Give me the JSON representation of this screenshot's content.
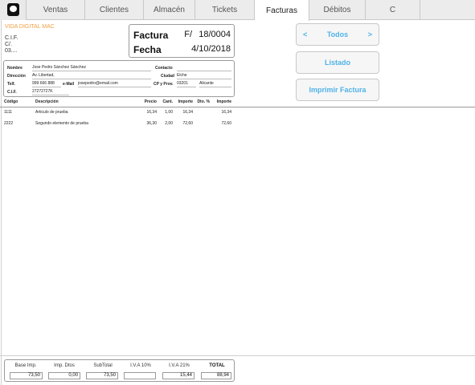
{
  "tabs": [
    "Ventas",
    "Clientes",
    "Almacén",
    "Tickets",
    "Facturas",
    "Débitos",
    "C"
  ],
  "active_tab": "Facturas",
  "company": {
    "name": "VIDA DIGITAL MAC",
    "cif": "C.I.F.",
    "line2": "C/.",
    "line3": "03...."
  },
  "invoice": {
    "factura_label": "Factura",
    "factura_prefix": "F/",
    "factura_number": "18/0004",
    "fecha_label": "Fecha",
    "fecha_value": "4/10/2018"
  },
  "customer": {
    "nombre_label": "Nombre",
    "nombre": "Jose Pedro Sánchez Sánchez",
    "contacto_label": "Contacto",
    "contacto": "",
    "direccion_label": "Dirección",
    "direccion": "Av. Libertad,",
    "ciudad_label": "Ciudad",
    "ciudad": "Elche",
    "telf_label": "Telf.",
    "telf": "999 666 888",
    "email_label": "e-Mail",
    "email": "josepedro@email.com",
    "cp_label": "CP y Prov.",
    "cp": "03201",
    "provincia": "Alicante",
    "cif_label": "C.I.F.",
    "cif": "27272727K"
  },
  "buttons": {
    "prev": "<",
    "todos": "Todos",
    "next": ">",
    "listado": "Listado",
    "imprimir": "Imprimir Factura"
  },
  "lines": {
    "headers": {
      "codigo": "Código",
      "descripcion": "Descripción",
      "precio": "Precio",
      "cant": "Cant.",
      "importe": "Importe",
      "dto": "Dto. %",
      "importe2": "Importe"
    },
    "rows": [
      {
        "codigo": "1111",
        "descripcion": "Articulo de prueba",
        "precio": "16,34",
        "cant": "1,00",
        "importe": "16,34",
        "dto": "",
        "importe2": "16,34"
      },
      {
        "codigo": "2222",
        "descripcion": "Segundo elemento de prueba",
        "precio": "36,30",
        "cant": "2,00",
        "importe": "72,60",
        "dto": "",
        "importe2": "72,60"
      }
    ]
  },
  "totals": {
    "base_label": "Base Imp.",
    "base": "73,50",
    "dtos_label": "Imp. Dtos",
    "dtos": "0,00",
    "subtotal_label": "SubTotal",
    "subtotal": "73,50",
    "iva10_label": "I.V.A 10%",
    "iva10": "",
    "iva21_label": "I.V.A 21%",
    "iva21": "15,44",
    "total_label": "TOTAL",
    "total": "88,94"
  },
  "colors": {
    "accent": "#4fb3e8",
    "company": "#f0a040"
  }
}
